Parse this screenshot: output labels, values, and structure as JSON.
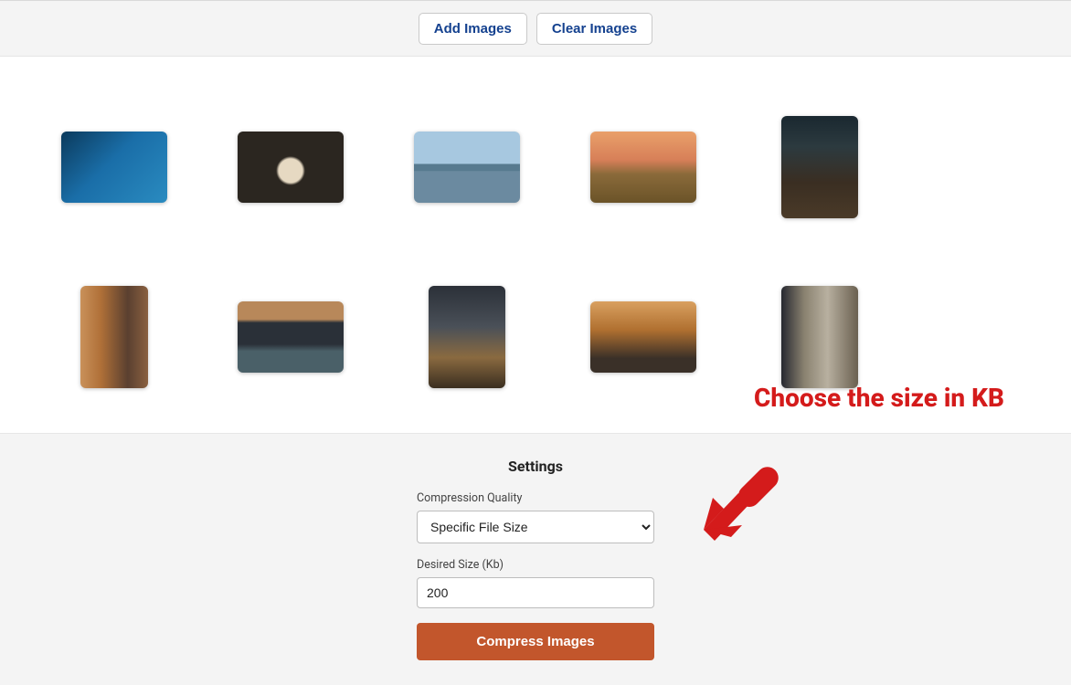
{
  "toolbar": {
    "add_label": "Add Images",
    "clear_label": "Clear Images"
  },
  "thumbnails": [
    {
      "name": "thumb-diver",
      "orient": "landscape",
      "gradient": "linear-gradient(135deg,#0b3a5c 0%,#1a6ea8 45%,#2a8bc0 100%)"
    },
    {
      "name": "thumb-tent",
      "orient": "landscape",
      "gradient": "radial-gradient(circle at 50% 55%, #e6d9c2 0 18%, #2b2620 22% 100%)"
    },
    {
      "name": "thumb-lake",
      "orient": "landscape",
      "gradient": "linear-gradient(180deg,#a7c8e0 0 45%,#577a8f 46% 55%,#6b8aa0 56% 100%)"
    },
    {
      "name": "thumb-field",
      "orient": "landscape",
      "gradient": "linear-gradient(180deg,#e9a06a 0%,#d77f58 40%,#8a6a3a 60%,#6b5328 100%)"
    },
    {
      "name": "thumb-path",
      "orient": "portrait",
      "gradient": "linear-gradient(180deg,#1a2830 0%,#2c3a3f 30%,#3a2e22 65%,#4a3a28 100%)"
    },
    {
      "name": "thumb-alley",
      "orient": "portrait-narrow",
      "gradient": "linear-gradient(90deg,#c9915a 0%,#b07038 30%,#5a4030 70%,#8a6040 100%)"
    },
    {
      "name": "thumb-arch",
      "orient": "landscape",
      "gradient": "linear-gradient(180deg,#b8885a 0 25%,#2a3038 30% 60%,#4a6068 70% 100%)"
    },
    {
      "name": "thumb-street",
      "orient": "portrait",
      "gradient": "linear-gradient(180deg,#2b3038 0%,#4a5058 40%,#8a6a40 70%,#3a2e20 100%)"
    },
    {
      "name": "thumb-city",
      "orient": "landscape",
      "gradient": "linear-gradient(180deg,#d9a060 0%,#b07030 40%,#3a3028 80%)"
    },
    {
      "name": "thumb-column",
      "orient": "portrait",
      "gradient": "linear-gradient(90deg,#262830 0%,#8a8270 30%,#b8b0a0 60%,#6a6050 100%)"
    }
  ],
  "settings": {
    "title": "Settings",
    "quality_label": "Compression Quality",
    "quality_value": "Specific File Size",
    "size_label": "Desired Size (Kb)",
    "size_value": "200",
    "compress_label": "Compress Images"
  },
  "annotation": {
    "text": "Choose the size in KB"
  }
}
